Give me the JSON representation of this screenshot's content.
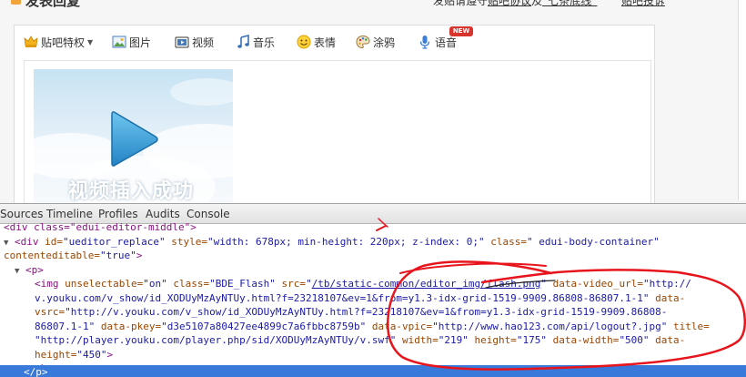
{
  "page": {
    "title": "发表回复",
    "notice_prefix": "发贴请遵守",
    "notice_link1": "贴吧协议",
    "notice_mid": "及",
    "notice_link2": "“七条底线”",
    "help_link": "贴吧投诉"
  },
  "toolbar": {
    "items": [
      {
        "label": "贴吧特权",
        "icon": "crown-icon"
      },
      {
        "label": "图片",
        "icon": "picture-icon"
      },
      {
        "label": "视频",
        "icon": "video-icon"
      },
      {
        "label": "音乐",
        "icon": "music-icon"
      },
      {
        "label": "表情",
        "icon": "smiley-icon"
      },
      {
        "label": "涂鸦",
        "icon": "palette-icon"
      },
      {
        "label": "语音",
        "icon": "microphone-icon"
      }
    ],
    "new_badge": "NEW",
    "dropdown_arrow": "▼"
  },
  "editor": {
    "thumb_caption": "视频插入成功"
  },
  "devtools": {
    "tabs": [
      "Sources",
      "Timeline",
      "Profiles",
      "Audits",
      "Console"
    ],
    "code": {
      "l0_tag": "<div class=\"edui-editor-middle\">",
      "l1_open": "<div ",
      "l1_a1": "id=",
      "l1_v1": "\"ueditor_replace\"",
      "l1_a2": " style=",
      "l1_v2": "\"width: 678px; min-height: 220px; z-index: 0;\"",
      "l1_a3": " class=",
      "l1_v3": "\" edui-body-container\"",
      "l2_a": "contenteditable=",
      "l2_v": "\"true\"",
      "l2_close": ">",
      "l3_tag": "<p>",
      "l4_open": "<img ",
      "l4_a1": "unselectable=",
      "l4_v1": "\"on\"",
      "l4_a2": " class=",
      "l4_v2": "\"BDE_Flash\"",
      "l4_a3": " src=",
      "l4_v3a": "\"",
      "l4_v3_link": "/tb/static-common/editor_img/flash.png",
      "l4_v3b": "\"",
      "l4_a4": " data-video_url=",
      "l4_v4": "\"http://",
      "l5_v": "v.youku.com/v_show/id_XODUyMzAyNTUy.html?f=23218107&ev=1&from=y1.3-idx-grid-1519-9909.86808-86807.1-1\"",
      "l5_a": " data-",
      "l6_a": "vsrc=",
      "l6_v": "\"http://v.youku.com/v_show/id_XODUyMzAyNTUy.html?f=23218107&ev=1&from=y1.3-idx-grid-1519-9909.86808-",
      "l7_v": "86807.1-1\"",
      "l7_a1": " data-pkey=",
      "l7_v1": "\"d3e5107a80427ee4899c7a6fbbc8759b\"",
      "l7_a2": " data-vpic=",
      "l7_v2": "\"http://www.hao123.com/api/logout?.jpg\"",
      "l7_a3": " title=",
      "l8_v1": "\"http://player.youku.com/player.php/sid/XODUyMzAyNTUy/v.swf\"",
      "l8_a2": " width=",
      "l8_v2": "\"219\"",
      "l8_a3": " height=",
      "l8_v3": "\"175\"",
      "l8_a4": " data-width=",
      "l8_v4": "\"500\"",
      "l8_a5": " data-",
      "l9_a": "height=",
      "l9_v": "\"450\"",
      "l9_close": ">",
      "l10_tag": "<br>",
      "l11_tag": "</p>"
    }
  },
  "colors": {
    "annotation": "#e8141c",
    "selection": "#3879d9"
  }
}
